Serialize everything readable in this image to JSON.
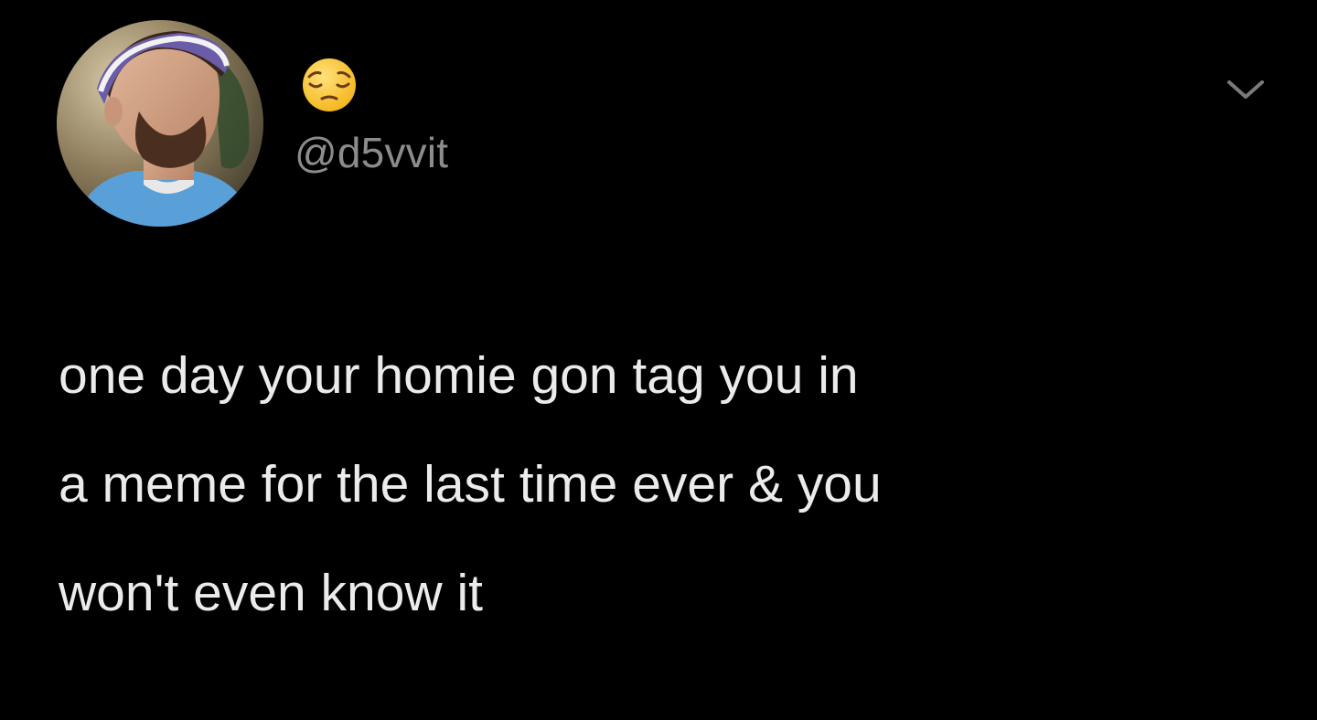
{
  "tweet": {
    "display_name_emoji": "😔",
    "handle": "@d5vvit",
    "text": "one day your homie gon tag you in\na meme for the last time ever & you\nwon't even know it"
  },
  "icons": {
    "menu": "chevron-down-icon",
    "avatar": "avatar-photo",
    "display_name": "pensive-face-emoji-icon"
  },
  "colors": {
    "background": "#000000",
    "text": "#ebebeb",
    "handle": "#8c8c8c"
  }
}
